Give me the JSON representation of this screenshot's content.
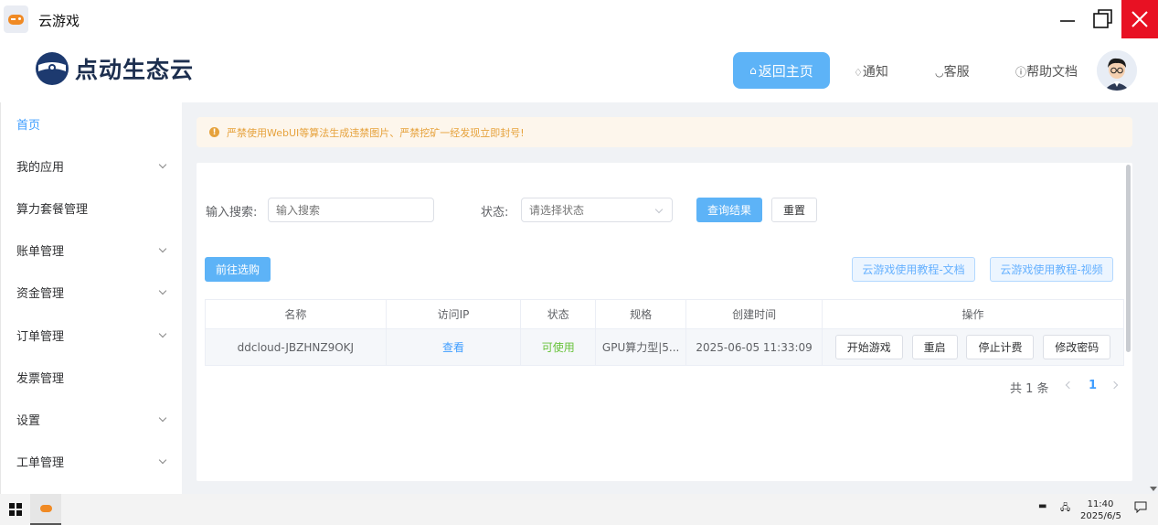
{
  "window": {
    "title": "云游戏"
  },
  "header": {
    "logo_text": "点动生态云",
    "nav": {
      "home": "返回主页",
      "notice": "通知",
      "service": "客服",
      "help": "帮助文档"
    }
  },
  "sidebar": {
    "items": [
      {
        "label": "首页",
        "active": true,
        "has_arrow": false
      },
      {
        "label": "我的应用",
        "active": false,
        "has_arrow": true
      },
      {
        "label": "算力套餐管理",
        "active": false,
        "has_arrow": false
      },
      {
        "label": "账单管理",
        "active": false,
        "has_arrow": true
      },
      {
        "label": "资金管理",
        "active": false,
        "has_arrow": true
      },
      {
        "label": "订单管理",
        "active": false,
        "has_arrow": true
      },
      {
        "label": "发票管理",
        "active": false,
        "has_arrow": false
      },
      {
        "label": "设置",
        "active": false,
        "has_arrow": true
      },
      {
        "label": "工单管理",
        "active": false,
        "has_arrow": true
      }
    ]
  },
  "warning": {
    "text": "严禁使用WebUI等算法生成违禁图片、严禁挖矿一经发现立即封号!"
  },
  "filters": {
    "search_label": "输入搜索:",
    "search_placeholder": "输入搜索",
    "status_label": "状态:",
    "status_placeholder": "请选择状态",
    "query_button": "查询结果",
    "reset_button": "重置"
  },
  "actions": {
    "goto_select": "前往选购",
    "tutorial_doc": "云游戏使用教程-文档",
    "tutorial_video": "云游戏使用教程-视频"
  },
  "table": {
    "columns": [
      "名称",
      "访问IP",
      "状态",
      "规格",
      "创建时间",
      "操作"
    ],
    "rows": [
      {
        "name": "ddcloud-JBZHNZ9OKJ",
        "ip": "查看",
        "status": "可使用",
        "spec": "GPU算力型|5...",
        "created": "2025-06-05 11:33:09",
        "ops": [
          "开始游戏",
          "重启",
          "停止计费",
          "修改密码"
        ]
      }
    ]
  },
  "pagination": {
    "total": "共 1 条",
    "current": "1"
  },
  "taskbar": {
    "time": "11:40",
    "date": "2025/6/5"
  },
  "colors": {
    "primary": "#5db3f7",
    "link": "#409eff",
    "success": "#67c23a",
    "warning": "#e6a23c",
    "close": "#e81123"
  }
}
